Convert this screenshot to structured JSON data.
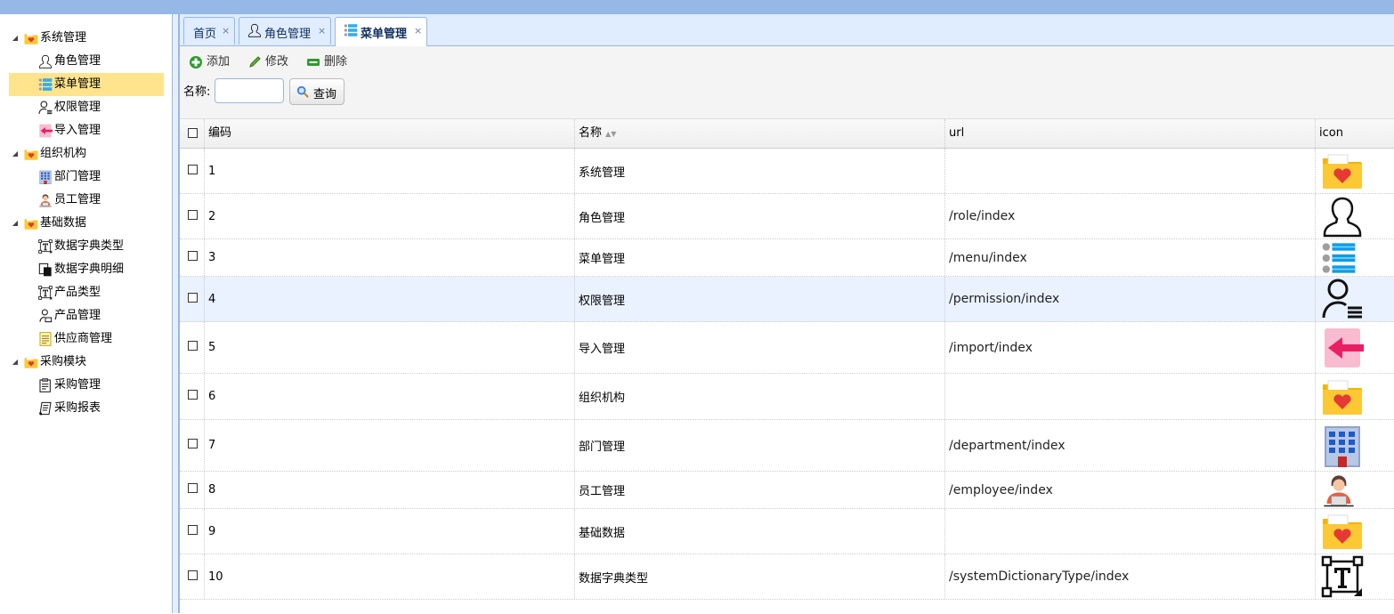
{
  "tree": [
    {
      "label": "系统管理",
      "level": 0,
      "icon": "folder-heart-icon",
      "expanded": true
    },
    {
      "label": "角色管理",
      "level": 1,
      "icon": "user-outline-icon"
    },
    {
      "label": "菜单管理",
      "level": 1,
      "icon": "menu-list-icon",
      "selected": true
    },
    {
      "label": "权限管理",
      "level": 1,
      "icon": "user-permission-icon"
    },
    {
      "label": "导入管理",
      "level": 1,
      "icon": "import-arrow-icon"
    },
    {
      "label": "组织机构",
      "level": 0,
      "icon": "folder-heart-icon",
      "expanded": true
    },
    {
      "label": "部门管理",
      "level": 1,
      "icon": "building-icon"
    },
    {
      "label": "员工管理",
      "level": 1,
      "icon": "employee-icon"
    },
    {
      "label": "基础数据",
      "level": 0,
      "icon": "folder-heart-icon",
      "expanded": true
    },
    {
      "label": "数据字典类型",
      "level": 1,
      "icon": "text-frame-icon"
    },
    {
      "label": "数据字典明细",
      "level": 1,
      "icon": "documents-icon"
    },
    {
      "label": "产品类型",
      "level": 1,
      "icon": "text-frame-icon"
    },
    {
      "label": "产品管理",
      "level": 1,
      "icon": "product-user-icon"
    },
    {
      "label": "供应商管理",
      "level": 1,
      "icon": "note-icon"
    },
    {
      "label": "采购模块",
      "level": 0,
      "icon": "folder-heart-icon",
      "expanded": true
    },
    {
      "label": "采购管理",
      "level": 1,
      "icon": "clipboard-icon"
    },
    {
      "label": "采购报表",
      "level": 1,
      "icon": "report-icon"
    }
  ],
  "tabs": [
    {
      "label": "首页",
      "close": "×",
      "icon": ""
    },
    {
      "label": "角色管理",
      "close": "×",
      "icon": "user-outline-icon"
    },
    {
      "label": "菜单管理",
      "close": "×",
      "icon": "menu-list-icon",
      "active": true
    }
  ],
  "toolbar": {
    "add_label": "添加",
    "edit_label": "修改",
    "delete_label": "删除",
    "search_label": "名称:",
    "search_value": "",
    "search_button": "查询"
  },
  "grid": {
    "headers": {
      "code": "编码",
      "name": "名称",
      "url": "url",
      "icon": "icon"
    },
    "rows": [
      {
        "code": "1",
        "name": "系统管理",
        "url": "",
        "icon": "folder-heart-icon"
      },
      {
        "code": "2",
        "name": "角色管理",
        "url": "/role/index",
        "icon": "user-outline-icon"
      },
      {
        "code": "3",
        "name": "菜单管理",
        "url": "/menu/index",
        "icon": "menu-list-icon"
      },
      {
        "code": "4",
        "name": "权限管理",
        "url": "/permission/index",
        "icon": "user-permission-icon",
        "highlight": true
      },
      {
        "code": "5",
        "name": "导入管理",
        "url": "/import/index",
        "icon": "import-arrow-icon"
      },
      {
        "code": "6",
        "name": "组织机构",
        "url": "",
        "icon": "folder-heart-icon"
      },
      {
        "code": "7",
        "name": "部门管理",
        "url": "/department/index",
        "icon": "building-icon"
      },
      {
        "code": "8",
        "name": "员工管理",
        "url": "/employee/index",
        "icon": "employee-icon"
      },
      {
        "code": "9",
        "name": "基础数据",
        "url": "",
        "icon": "folder-heart-icon"
      },
      {
        "code": "10",
        "name": "数据字典类型",
        "url": "/systemDictionaryType/index",
        "icon": "text-frame-icon"
      }
    ]
  },
  "colors": {
    "accent": "#95b8e7",
    "selected": "#ffe48d",
    "highlight_row": "#eaf2ff"
  }
}
